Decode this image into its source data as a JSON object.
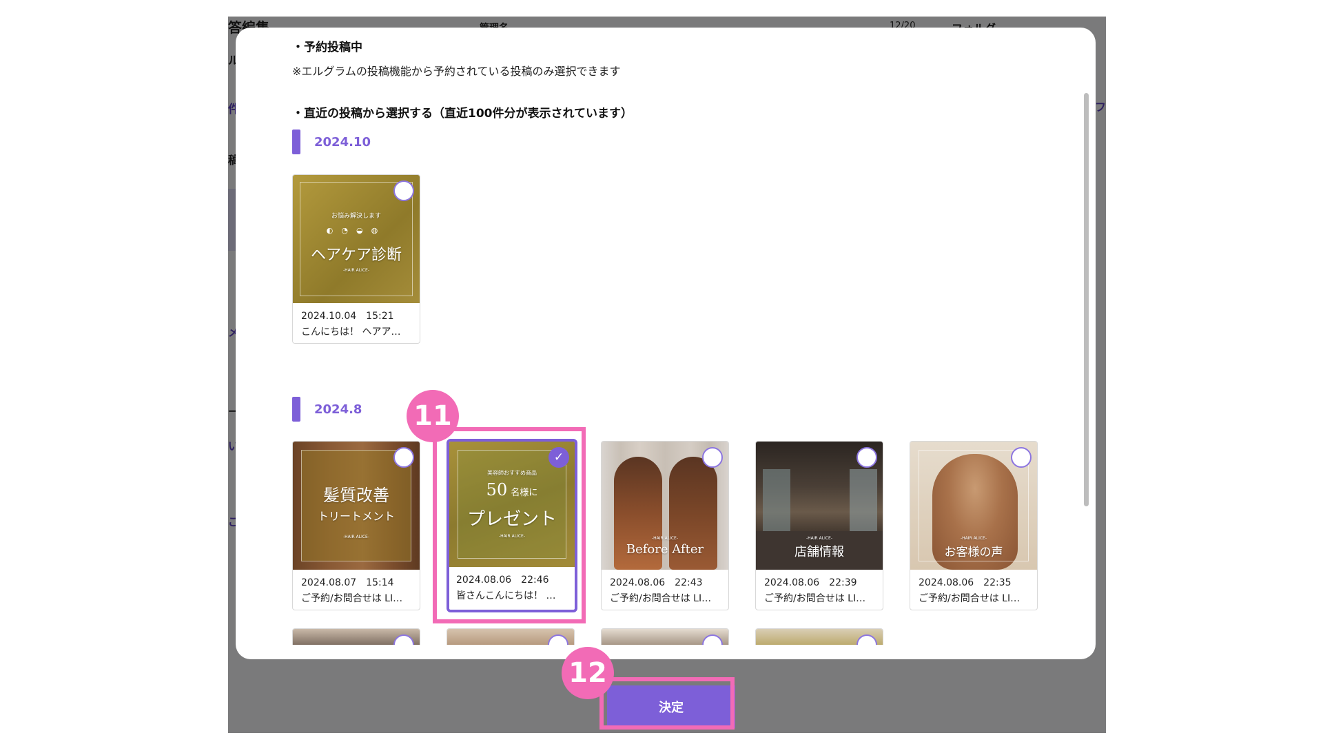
{
  "background": {
    "fragments": [
      "答編集",
      "管理名",
      "12/20",
      "フォルダ",
      "ル",
      "件",
      "フ",
      "稿",
      "メ",
      "ー",
      "い",
      "ご"
    ]
  },
  "modal": {
    "scheduled_heading": "・予約投稿中",
    "scheduled_note": "※エルグラムの投稿機能から予約されている投稿のみ選択できます",
    "recent_heading": "・直近の投稿から選択する（直近100件分が表示されています）",
    "months": [
      {
        "label": "2024.10",
        "posts": [
          {
            "date": "2024.10.04　15:21",
            "caption": "こんにちは！ ヘアア…",
            "thumb_small": "お悩み解決します",
            "thumb_title": "ヘアケア診断",
            "thumb_brand": "-HAIR ALICE-",
            "selected": false
          }
        ]
      },
      {
        "label": "2024.8",
        "posts": [
          {
            "date": "2024.08.07　15:14",
            "caption": "ご予約/お問合せは LI…",
            "thumb_title": "髪質改善",
            "thumb_sub": "トリートメント",
            "thumb_brand": "-HAIR ALICE-",
            "selected": false
          },
          {
            "date": "2024.08.06　22:46",
            "caption": "皆さんこんにちは！ …",
            "thumb_small": "美容師おすすめ商品",
            "thumb_title": "50",
            "thumb_title_suffix": "名様に",
            "thumb_sub": "プレゼント",
            "thumb_brand": "-HAIR ALICE-",
            "selected": true
          },
          {
            "date": "2024.08.06　22:43",
            "caption": "ご予約/お問合せは LI…",
            "thumb_brand": "-HAIR ALICE-",
            "thumb_title": "Before After",
            "selected": false
          },
          {
            "date": "2024.08.06　22:39",
            "caption": "ご予約/お問合せは LI…",
            "thumb_brand": "-HAIR ALICE-",
            "thumb_title": "店舗情報",
            "selected": false
          },
          {
            "date": "2024.08.06　22:35",
            "caption": "ご予約/お問合せは LI…",
            "thumb_brand": "-HAIR ALICE-",
            "thumb_title": "お客様の声",
            "selected": false
          }
        ]
      }
    ],
    "check_icon": "✓"
  },
  "annotations": {
    "step_11": "11",
    "step_12": "12"
  },
  "footer": {
    "confirm_label": "決定"
  },
  "colors": {
    "accent": "#7d5fd8",
    "highlight": "#f26bb6"
  }
}
